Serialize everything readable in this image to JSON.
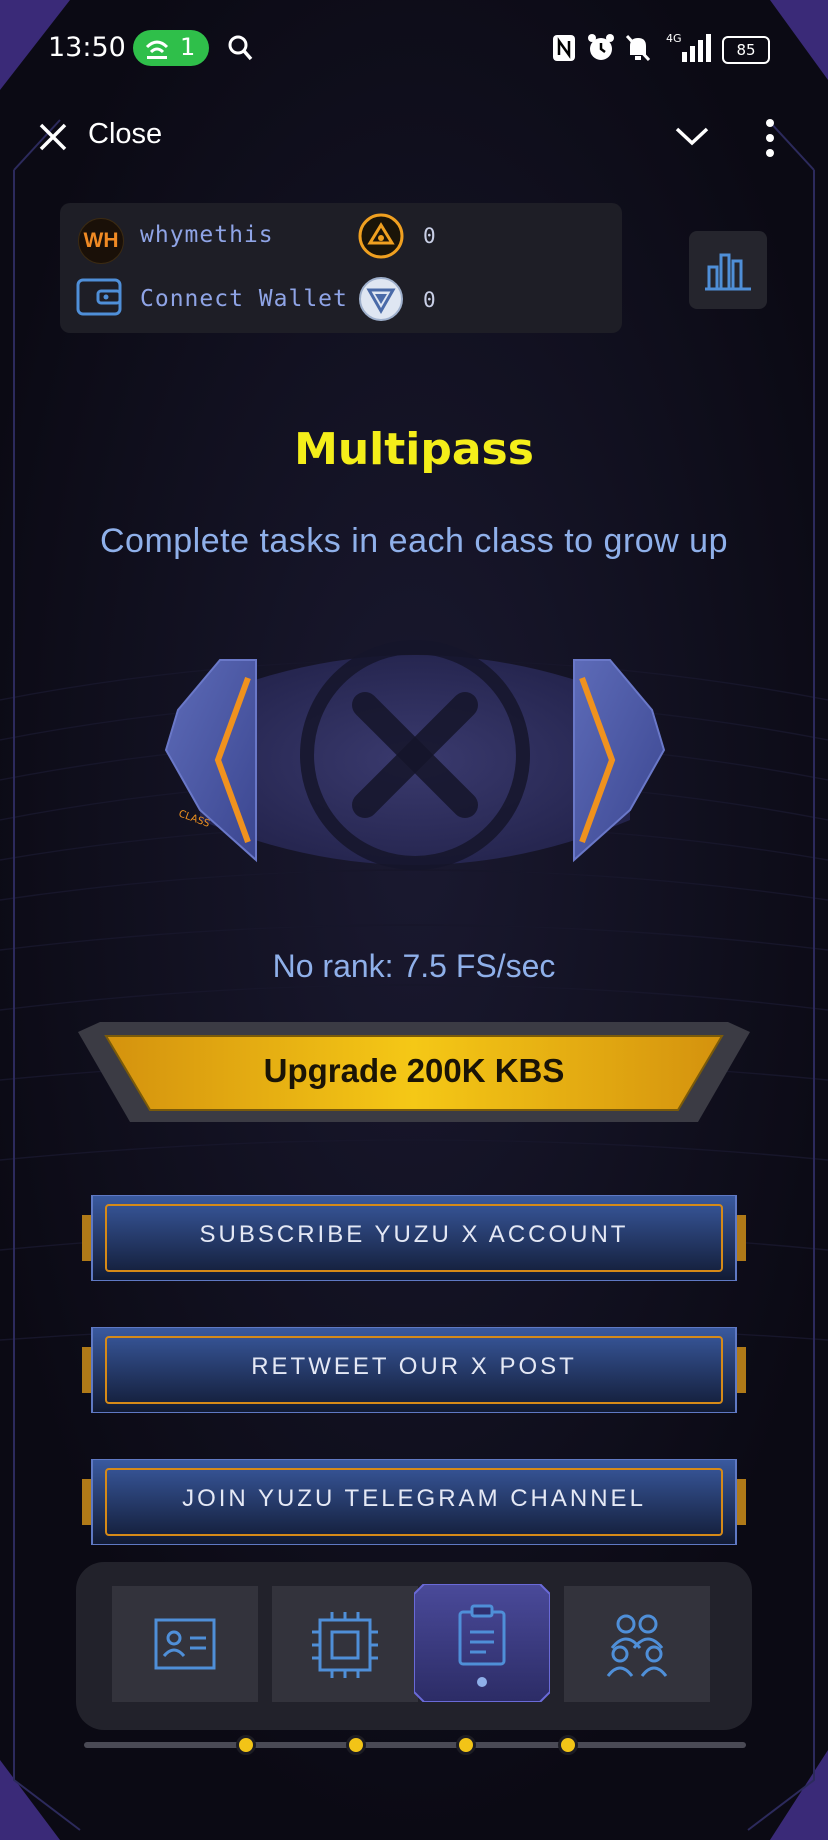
{
  "status_bar": {
    "time": "13:50",
    "hotspot_count": "1",
    "battery": "85"
  },
  "header": {
    "close_label": "Close"
  },
  "user_card": {
    "avatar_initials": "WH",
    "username": "whymethis",
    "wallet_label": "Connect Wallet",
    "token_count_1": "0",
    "token_count_2": "0"
  },
  "main": {
    "title": "Multipass",
    "subtitle": "Complete tasks in each class to grow up",
    "rank_text": "No rank: 7.5 FS/sec",
    "badge_text": "CLASS",
    "upgrade_label": "Upgrade 200K KBS"
  },
  "tasks": [
    {
      "label": "SUBSCRIBE YUZU X ACCOUNT"
    },
    {
      "label": "RETWEET OUR X POST"
    },
    {
      "label": "JOIN YUZU TELEGRAM CHANNEL"
    }
  ],
  "nav": {
    "tabs": [
      {
        "icon": "id-card-icon",
        "active": false
      },
      {
        "icon": "chip-icon",
        "active": false
      },
      {
        "icon": "clipboard-icon",
        "active": true
      },
      {
        "icon": "users-icon",
        "active": false
      }
    ],
    "active_index": 2
  },
  "colors": {
    "accent_yellow": "#f4ee1a",
    "text_blue": "#8fb0ea",
    "orange": "#f08a24",
    "button_gold": "#e3a40d"
  }
}
